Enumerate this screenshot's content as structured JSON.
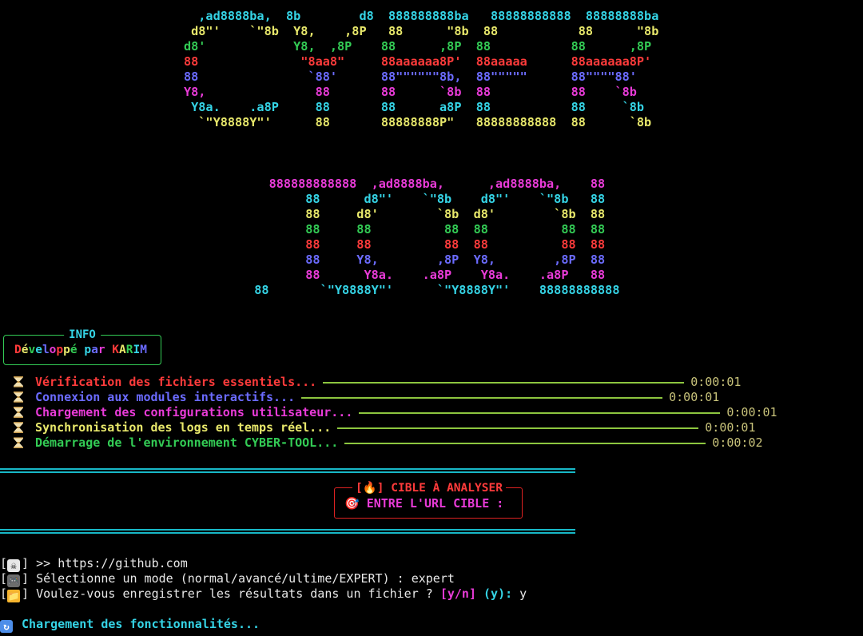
{
  "banner": {
    "cyber_lines": [
      {
        "text": "  ,ad8888ba,  8b        d8  888888888ba   88888888888  88888888ba",
        "color": "#35d4e6"
      },
      {
        "text": " d8\"'    `\"8b  Y8,    ,8P   88      \"8b  88           88      \"8b",
        "color": "#e8e86b"
      },
      {
        "text": "d8'            Y8,  ,8P    88      ,8P  88           88      ,8P",
        "color": "#33cc55"
      },
      {
        "text": "88              \"8aa8\"     88aaaaaa8P'  88aaaaa      88aaaaaa8P'",
        "color": "#ff3b3b"
      },
      {
        "text": "88               `88'      88\"\"\"\"\"\"8b,  88\"\"\"\"\"      88\"\"\"\"88'",
        "color": "#6b6bff"
      },
      {
        "text": "Y8,               88       88      `8b  88           88    `8b",
        "color": "#e93bd8"
      },
      {
        "text": " Y8a.    .a8P     88       88      a8P  88           88     `8b",
        "color": "#35d4e6"
      },
      {
        "text": "  `\"Y8888Y\"'      88       88888888P\"   88888888888  88      `8b",
        "color": "#e8e86b"
      }
    ],
    "tool_lines": [
      {
        "text": "    888888888888  ,ad8888ba,      ,ad8888ba,    88",
        "color": "#e93bd8"
      },
      {
        "text": "         88      d8\"'    `\"8b    d8\"'    `\"8b   88",
        "color": "#35d4e6"
      },
      {
        "text": "         88     d8'        `8b  d8'        `8b  88",
        "color": "#e8e86b"
      },
      {
        "text": "         88     88          88  88          88  88",
        "color": "#33cc55"
      },
      {
        "text": "         88     88          88  88          88  88",
        "color": "#ff3b3b"
      },
      {
        "text": "         88     Y8,        ,8P  Y8,        ,8P  88",
        "color": "#6b6bff"
      },
      {
        "text": "         88      Y8a.    .a8P    Y8a.    .a8P   88",
        "color": "#e93bd8"
      },
      {
        "text": "  88       `\"Y8888Y\"'      `\"Y8888Y\"'    88888888888",
        "color": "#35d4e6"
      }
    ]
  },
  "info": {
    "title": "INFO",
    "text": "Développé par KARIM",
    "rainbow": [
      "#ff3b3b",
      "#e8e86b",
      "#33cc55",
      "#35d4e6",
      "#6b6bff",
      "#e93bd8"
    ]
  },
  "tasks": [
    {
      "label": "Vérification des fichiers essentiels...",
      "time": "0:00:01",
      "color": "#ff3b3b",
      "bar_color": "#8dc63f",
      "bar_width": 452
    },
    {
      "label": "Connexion aux modules interactifs...",
      "time": "0:00:01",
      "color": "#6b6bff",
      "bar_color": "#8dc63f",
      "bar_width": 452
    },
    {
      "label": "Chargement des configurations utilisateur...",
      "time": "0:00:01",
      "color": "#e93bd8",
      "bar_color": "#8dc63f",
      "bar_width": 452
    },
    {
      "label": "Synchronisation des logs en temps réel...",
      "time": "0:00:01",
      "color": "#e8e86b",
      "bar_color": "#8dc63f",
      "bar_width": 452
    },
    {
      "label": "Démarrage de l'environnement CYBER-TOOL...",
      "time": "0:00:02",
      "color": "#33cc55",
      "bar_color": "#8dc63f",
      "bar_width": 452
    }
  ],
  "target": {
    "title": "[🔥] CIBLE À ANALYSER",
    "prompt": "🎯 ENTRE L'URL CIBLE :"
  },
  "terminal": {
    "url_prefix": "] >> ",
    "url_value": "https://github.com",
    "mode_prompt": "] Sélectionne un mode (normal/avancé/ultime/EXPERT) : ",
    "mode_value": "expert",
    "save_prompt": "] Voulez-vous enregistrer les résultats dans un fichier ? ",
    "save_choices": "[y/n]",
    "save_default": "(y):",
    "save_value": " y",
    "loading": " Chargement des fonctionnalités..."
  }
}
